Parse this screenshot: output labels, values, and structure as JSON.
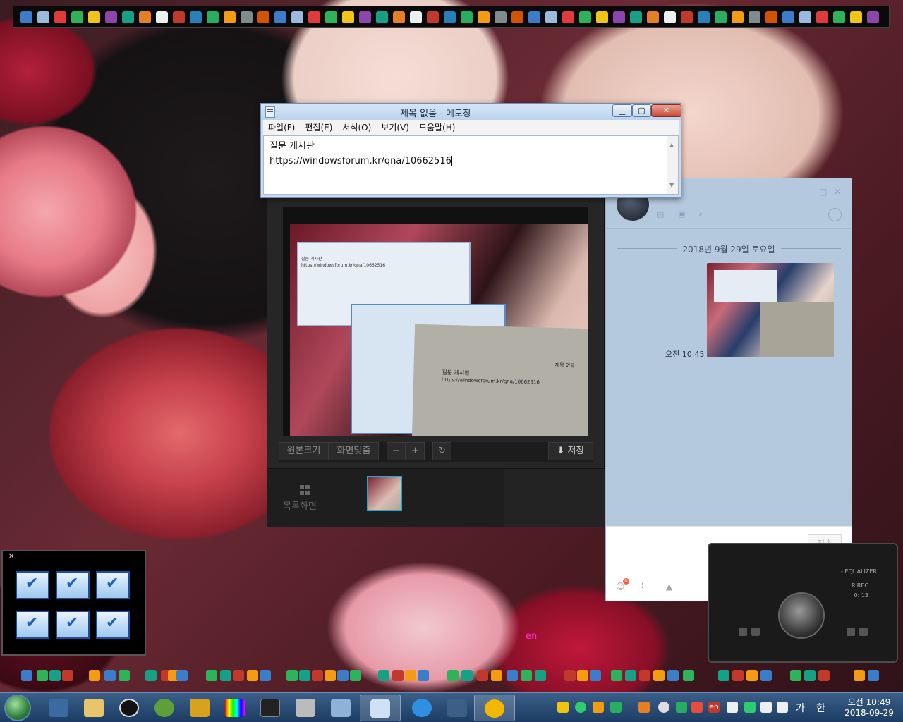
{
  "notepad": {
    "title": "제목 없음 - 메모장",
    "menu": [
      "파일(F)",
      "편집(E)",
      "서식(O)",
      "보기(V)",
      "도움말(H)"
    ],
    "lines": [
      "질문 게시판",
      "https://windowsforum.kr/qna/10662516"
    ]
  },
  "viewer": {
    "buttons": {
      "original_size": "원본크기",
      "fit_screen": "화면맞춤",
      "zoom_out": "−",
      "zoom_in": "+",
      "save": "저장"
    },
    "list_view": "목록화면",
    "photo_text": {
      "paper_line1": "질문 게시판",
      "paper_line2": "https://windowsforum.kr/qna/10662516",
      "paper_title": "제목 없음",
      "notepad_line1": "질문 게시판",
      "notepad_line2": "https://windowsforum.kr/qna/10662516"
    }
  },
  "chat": {
    "date_separator": "2018년 9월 29일 토요일",
    "message_time": "오전 10:45",
    "send_button": "전송",
    "badge": "N"
  },
  "player": {
    "equalizer_label": "- EQUALIZER",
    "rec_label": "R.REC",
    "time": "0: 13"
  },
  "desktop": {
    "ime_indicator": "en"
  },
  "taskbar": {
    "tray_lang": "en",
    "ime_hangul": "가",
    "ime_han": "한",
    "clock_time": "오전 10:49",
    "clock_date": "2018-09-29"
  },
  "colors": {
    "taskbar": "#1c3c63",
    "notepad_frame": "#c9dcf2",
    "chat_bg": "#b4c8de",
    "viewer_bg": "#262626"
  }
}
